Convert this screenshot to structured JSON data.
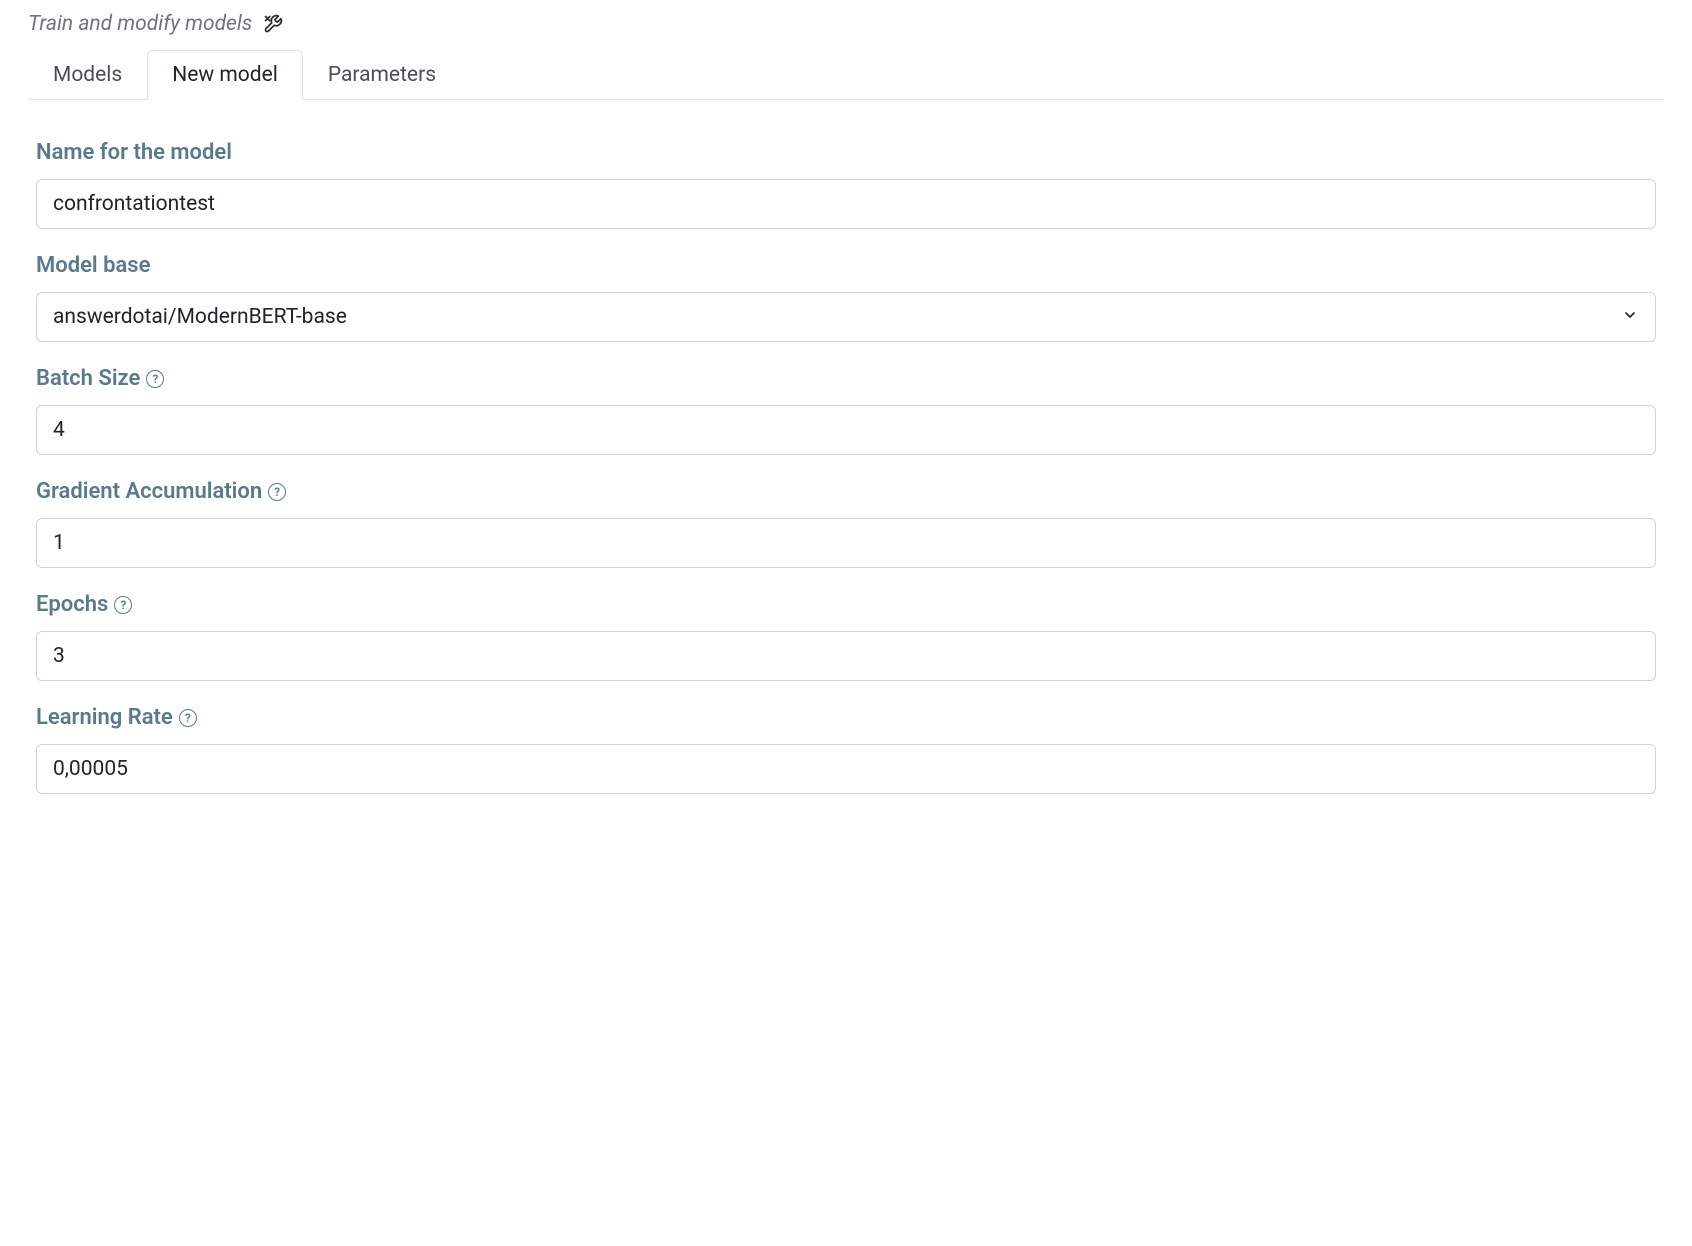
{
  "header": {
    "title": "Train and modify models"
  },
  "tabs": [
    {
      "label": "Models",
      "active": false
    },
    {
      "label": "New model",
      "active": true
    },
    {
      "label": "Parameters",
      "active": false
    }
  ],
  "form": {
    "name": {
      "label": "Name for the model",
      "value": "confrontationtest"
    },
    "model_base": {
      "label": "Model base",
      "value": "answerdotai/ModernBERT-base"
    },
    "batch_size": {
      "label": "Batch Size",
      "value": "4",
      "has_help": true
    },
    "gradient_accumulation": {
      "label": "Gradient Accumulation",
      "value": "1",
      "has_help": true
    },
    "epochs": {
      "label": "Epochs",
      "value": "3",
      "has_help": true
    },
    "learning_rate": {
      "label": "Learning Rate",
      "value": "0,00005",
      "has_help": true
    }
  }
}
